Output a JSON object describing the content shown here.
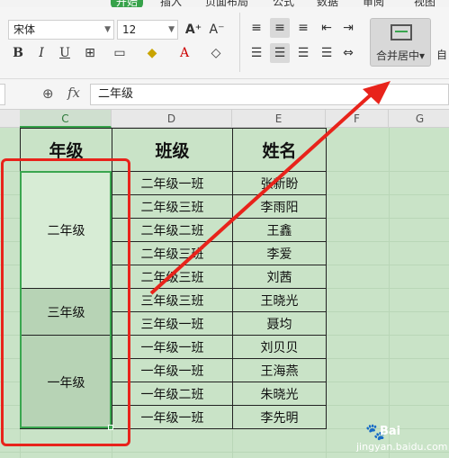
{
  "tabs": [
    "开始",
    "插入",
    "页面布局",
    "公式",
    "数据",
    "审阅",
    "视图"
  ],
  "ribbon": {
    "font_name": "宋体",
    "font_size": "12",
    "bold": "B",
    "italic": "I",
    "underline": "U",
    "font_color_glyph": "A",
    "merge_label": "合并居中",
    "merge_dropdown": "▾",
    "auto_label": "自"
  },
  "formula_bar": {
    "fx": "fx",
    "value": "二年级"
  },
  "columns": [
    "C",
    "D",
    "E",
    "F",
    "G"
  ],
  "table": {
    "headers": [
      "年级",
      "班级",
      "姓名"
    ],
    "grades": [
      {
        "label": "二年级",
        "rows": 5
      },
      {
        "label": "三年级",
        "rows": 2
      },
      {
        "label": "一年级",
        "rows": 4
      }
    ],
    "rows": [
      {
        "class": "二年级一班",
        "name": "张新盼"
      },
      {
        "class": "二年级三班",
        "name": "李雨阳"
      },
      {
        "class": "二年级二班",
        "name": "王鑫"
      },
      {
        "class": "二年级三班",
        "name": "李爱"
      },
      {
        "class": "二年级三班",
        "name": "刘茜"
      },
      {
        "class": "三年级三班",
        "name": "王晓光"
      },
      {
        "class": "三年级一班",
        "name": "聂均"
      },
      {
        "class": "一年级一班",
        "name": "刘贝贝"
      },
      {
        "class": "一年级一班",
        "name": "王海燕"
      },
      {
        "class": "一年级二班",
        "name": "朱晓光"
      },
      {
        "class": "一年级一班",
        "name": "李先明"
      }
    ]
  },
  "watermark": {
    "brand": "Bai",
    "url": "jingyan.baidu.com"
  },
  "colors": {
    "grid_bg": "#c9e3c7",
    "selection": "#3aa64f",
    "annotation": "#e8231b"
  }
}
